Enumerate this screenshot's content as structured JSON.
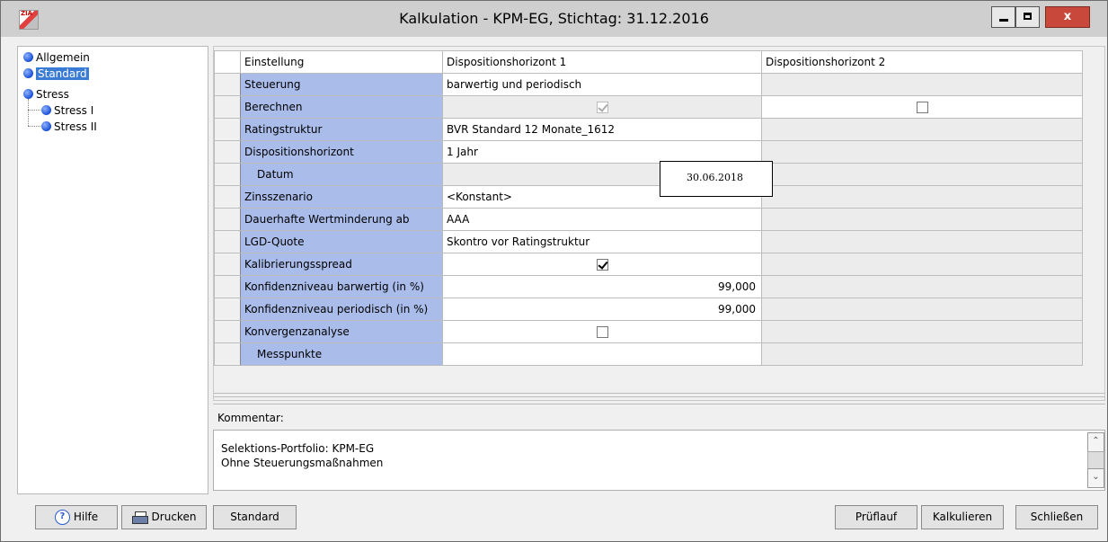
{
  "window": {
    "title": "Kalkulation - KPM-EG, Stichtag: 31.12.2016",
    "app_icon_text": "ZIA",
    "close_label": "x"
  },
  "tree": {
    "items": [
      {
        "label": "Allgemein"
      },
      {
        "label": "Standard",
        "selected": true
      },
      {
        "label": "Stress"
      },
      {
        "label": "Stress I"
      },
      {
        "label": "Stress II"
      }
    ]
  },
  "grid": {
    "headers": [
      "Einstellung",
      "Dispositionshorizont 1",
      "Dispositionshorizont 2"
    ],
    "rows": [
      {
        "label": "Steuerung",
        "c1": "barwertig und periodisch",
        "c2": ""
      },
      {
        "label": "Berechnen",
        "c1_checkbox": "checked-disabled",
        "c2_checkbox": "unchecked"
      },
      {
        "label": "Ratingstruktur",
        "c1": "BVR Standard 12 Monate_1612",
        "c2": ""
      },
      {
        "label": "Dispositionshorizont",
        "c1": "1 Jahr",
        "c2": ""
      },
      {
        "label": "Datum",
        "c1": "",
        "c2": ""
      },
      {
        "label": "Zinsszenario",
        "c1": "<Konstant>",
        "c2": ""
      },
      {
        "label": "Dauerhafte Wertminderung ab",
        "c1": "AAA",
        "c2": ""
      },
      {
        "label": "LGD-Quote",
        "c1": "Skontro vor Ratingstruktur",
        "c2": ""
      },
      {
        "label": "Kalibrierungsspread",
        "c1_checkbox": "checked",
        "c2": ""
      },
      {
        "label": "Konfidenzniveau barwertig (in %)",
        "c1": "99,000",
        "c2": ""
      },
      {
        "label": "Konfidenzniveau periodisch (in %)",
        "c1": "99,000",
        "c2": ""
      },
      {
        "label": "Konvergenzanalyse",
        "c1_checkbox": "unchecked",
        "c2": ""
      },
      {
        "label": "Messpunkte",
        "c1": "",
        "c2": ""
      }
    ],
    "date_popup": "30.06.2018"
  },
  "comment": {
    "label": "Kommentar:",
    "lines": [
      "Selektions-Portfolio: KPM-EG",
      "Ohne Steuerungsmaßnahmen"
    ]
  },
  "buttons": {
    "help": "Hilfe",
    "print": "Drucken",
    "standard": "Standard",
    "check": "Prüflauf",
    "calculate": "Kalkulieren",
    "close": "Schließen"
  }
}
